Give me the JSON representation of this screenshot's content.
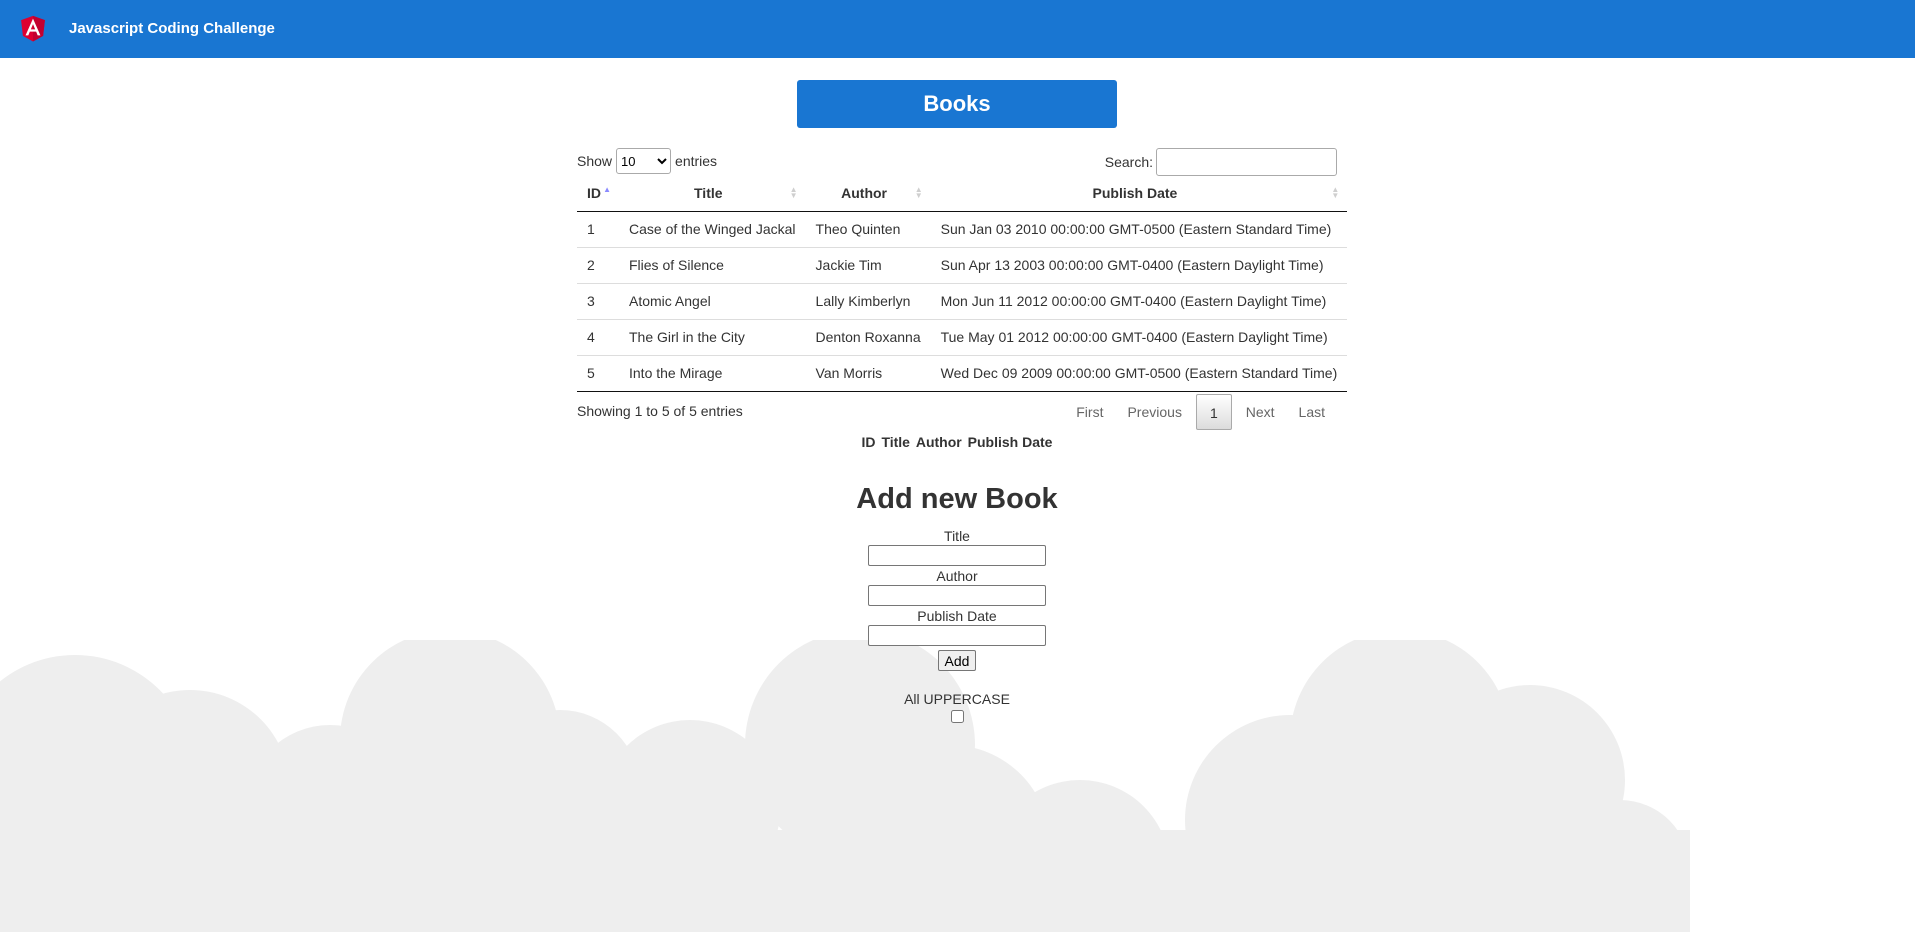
{
  "toolbar": {
    "title": "Javascript Coding Challenge",
    "logo_icon": "angular-logo-icon"
  },
  "books": {
    "heading": "Books"
  },
  "table_controls": {
    "show_label": "Show",
    "page_size": "10",
    "entries_label": "entries",
    "search_label": "Search:",
    "search_value": ""
  },
  "table": {
    "columns": [
      "ID",
      "Title",
      "Author",
      "Publish Date"
    ],
    "rows": [
      [
        "1",
        "Case of the Winged Jackal",
        "Theo Quinten",
        "Sun Jan 03 2010 00:00:00 GMT-0500 (Eastern Standard Time)"
      ],
      [
        "2",
        "Flies of Silence",
        "Jackie Tim",
        "Sun Apr 13 2003 00:00:00 GMT-0400 (Eastern Daylight Time)"
      ],
      [
        "3",
        "Atomic Angel",
        "Lally Kimberlyn",
        "Mon Jun 11 2012 00:00:00 GMT-0400 (Eastern Daylight Time)"
      ],
      [
        "4",
        "The Girl in the City",
        "Denton Roxanna",
        "Tue May 01 2012 00:00:00 GMT-0400 (Eastern Daylight Time)"
      ],
      [
        "5",
        "Into the Mirage",
        "Van Morris",
        "Wed Dec 09 2009 00:00:00 GMT-0500 (Eastern Standard Time)"
      ]
    ]
  },
  "table_info": "Showing 1 to 5 of 5 entries",
  "pagination": {
    "first": "First",
    "previous": "Previous",
    "current": "1",
    "next": "Next",
    "last": "Last"
  },
  "footer_headers": [
    "ID",
    "Title",
    "Author",
    "Publish Date"
  ],
  "add_form": {
    "heading": "Add new Book",
    "title_label": "Title",
    "author_label": "Author",
    "date_label": "Publish Date",
    "add_button": "Add",
    "uppercase_label": "All UPPERCASE"
  },
  "colors": {
    "brand": "#1976d2",
    "logo_red": "#dd0031",
    "cloud": "#eeeeee"
  }
}
